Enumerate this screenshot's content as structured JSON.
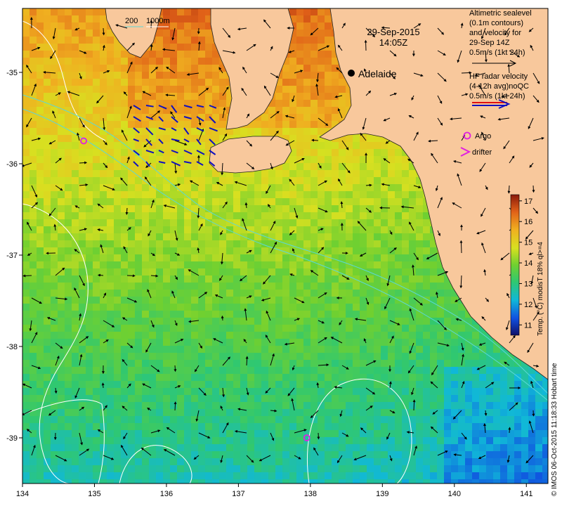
{
  "map": {
    "date": "29-Sep-2015",
    "time": "14:05Z",
    "city": "Adelaide",
    "depth_labels": [
      "200",
      "1000m"
    ],
    "legend": {
      "altimetry_lines": [
        "Altimetric sealevel",
        "(0.1m contours)",
        "and velocity for",
        "29-Sep 14Z",
        "0.5m/s (1kt 24h)"
      ],
      "hf_lines": [
        "HF radar velocity",
        "(4-12h avg)noQC",
        "0.5m/s (1kt 24h)"
      ],
      "argo": "Argo",
      "drifter": "drifter"
    },
    "colorbar": {
      "label": "Temp. (°C) modisT 18% ql>=4",
      "ticks": [
        "17",
        "16",
        "15",
        "14",
        "13",
        "12",
        "11"
      ],
      "min": 10.5,
      "max": 17.3
    },
    "x_ticks": [
      "134",
      "135",
      "136",
      "137",
      "138",
      "139",
      "140",
      "141"
    ],
    "y_ticks": [
      "-35",
      "-36",
      "-37",
      "-38",
      "-39"
    ],
    "credit": "© IMOS 06-Oct-2015 11:18:33 Hobart time",
    "lon_range": [
      134,
      141.3
    ],
    "lat_range": [
      -34.3,
      -39.5
    ],
    "argo_floats": [
      [
        134.85,
        -35.75
      ],
      [
        137.95,
        -39.0
      ]
    ],
    "colors": {
      "land": "#f8c89c",
      "argo": "#e020e0",
      "hf_red": "#e01010",
      "hf_blue": "#1010c0",
      "contour": "#ffffff",
      "isobath": "#5bd8d8"
    }
  }
}
